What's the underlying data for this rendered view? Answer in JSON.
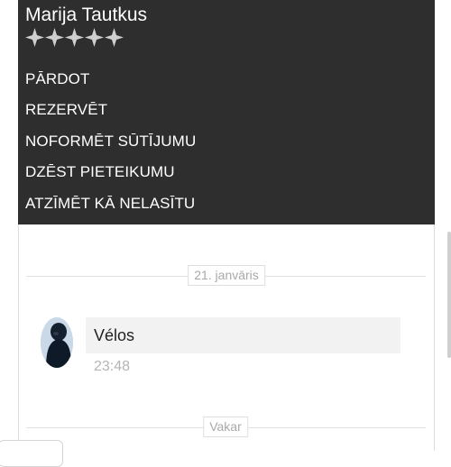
{
  "seller": {
    "name": "Marija Tautkus",
    "rating_stars": 5,
    "star_color": "#cfcfcf"
  },
  "menu": {
    "items": [
      {
        "label": "PĀRDOT"
      },
      {
        "label": "REZERVĒT"
      },
      {
        "label": "NOFORMĒT SŪTĪJUMU"
      },
      {
        "label": "DZĒST PIETEIKUMU"
      },
      {
        "label": "ATZĪMĒT KĀ NELASĪTU"
      }
    ]
  },
  "chat": {
    "date_separator_1": "21. janvāris",
    "message": {
      "text": "Vélos",
      "time": "23:48"
    },
    "date_separator_2": "Vakar"
  },
  "colors": {
    "menu_bg": "#2e2e2e",
    "bubble_bg": "#f2f2f2"
  }
}
